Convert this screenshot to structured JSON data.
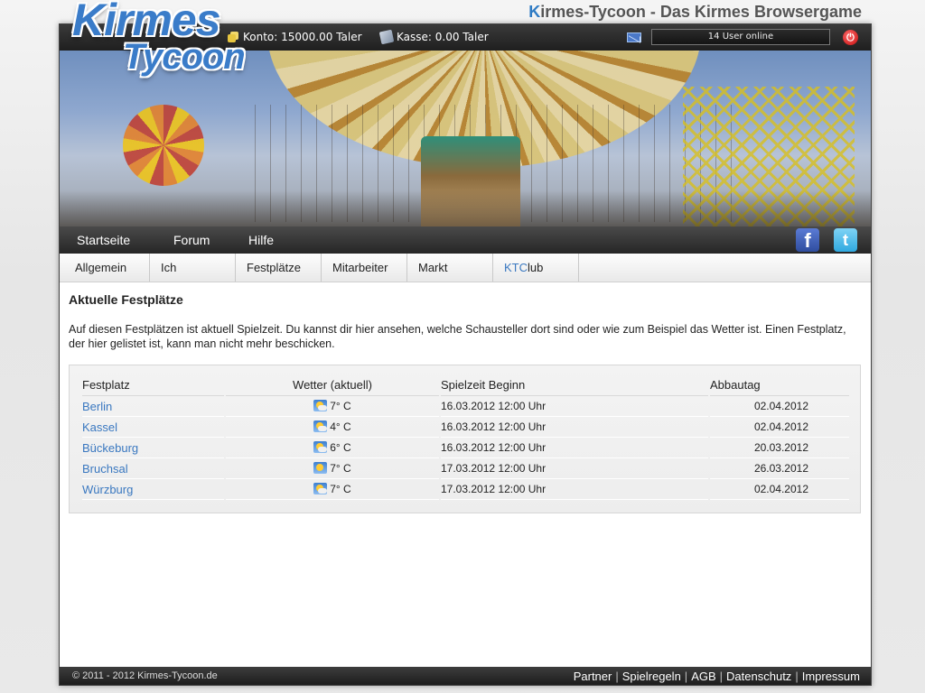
{
  "site_title": {
    "k": "K",
    "rest": "irmes-Tycoon - Das Kirmes Browsergame"
  },
  "logo": {
    "line1": "Kirmes",
    "line2": "Tycoon"
  },
  "topbar": {
    "konto": "Konto: 15000.00 Taler",
    "kasse": "Kasse: 0.00 Taler",
    "online": "14 User online",
    "power_symbol": "⏻"
  },
  "mainnav": {
    "items": [
      "Startseite",
      "Forum",
      "Hilfe"
    ],
    "facebook": "f",
    "twitter": "t"
  },
  "subnav": {
    "items": [
      "Allgemein",
      "Ich",
      "Festplätze",
      "Mitarbeiter",
      "Markt"
    ],
    "ktclub": {
      "kt": "KT",
      "c": "C",
      "lub": "lub"
    }
  },
  "content": {
    "title": "Aktuelle Festplätze",
    "intro": "Auf diesen Festplätzen ist aktuell Spielzeit. Du kannst dir hier ansehen, welche Schausteller dort sind oder wie zum Beispiel das Wetter ist. Einen Festplatz, der hier gelistet ist, kann man nicht mehr beschicken."
  },
  "table": {
    "headers": [
      "Festplatz",
      "Wetter (aktuell)",
      "Spielzeit Beginn",
      "Abbautag"
    ],
    "rows": [
      {
        "city": "Berlin",
        "weather_icon": "sun-cloud-icon",
        "temp": "7° C",
        "start": "16.03.2012 12:00 Uhr",
        "end": "02.04.2012"
      },
      {
        "city": "Kassel",
        "weather_icon": "sun-cloud-icon",
        "temp": "4° C",
        "start": "16.03.2012 12:00 Uhr",
        "end": "02.04.2012"
      },
      {
        "city": "Bückeburg",
        "weather_icon": "sun-cloud-icon",
        "temp": "6° C",
        "start": "16.03.2012 12:00 Uhr",
        "end": "20.03.2012"
      },
      {
        "city": "Bruchsal",
        "weather_icon": "sun-icon",
        "temp": "7° C",
        "start": "17.03.2012 12:00 Uhr",
        "end": "26.03.2012"
      },
      {
        "city": "Würzburg",
        "weather_icon": "sun-cloud-icon",
        "temp": "7° C",
        "start": "17.03.2012 12:00 Uhr",
        "end": "02.04.2012"
      }
    ]
  },
  "footer": {
    "copyright": "© 2011 - 2012 Kirmes-Tycoon.de",
    "links": [
      "Partner",
      "Spielregeln",
      "AGB",
      "Datenschutz",
      "Impressum"
    ]
  },
  "colors": {
    "accent": "#3a78c0",
    "bar": "#2a2a2a",
    "ktclub_c": "#e05a2a"
  }
}
